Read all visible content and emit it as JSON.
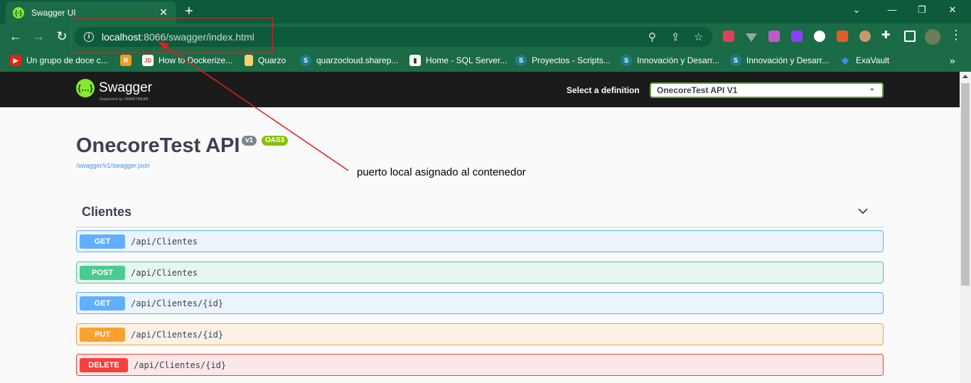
{
  "browser": {
    "tab_title": "Swagger UI",
    "tab_favicon": "{-}",
    "url_host": "localhost",
    "url_rest": ":8066/swagger/index.html",
    "bookmarks": [
      {
        "label": "Un grupo de doce c...",
        "icon": "youtube-icon",
        "color": "#e62117",
        "glyph": "▶"
      },
      {
        "label": "",
        "icon": "r-icon",
        "color": "#f29c1f",
        "glyph": "R"
      },
      {
        "label": "How to Dockerize...",
        "icon": "jd-icon",
        "color": "#ffffff",
        "glyph": "JD"
      },
      {
        "label": "Quarzo",
        "icon": "folder-icon",
        "color": "#f3d36b",
        "glyph": ""
      },
      {
        "label": "quarzocloud.sharep...",
        "icon": "sharepoint-icon",
        "color": "#1a7f8c",
        "glyph": "S"
      },
      {
        "label": "Home - SQL Server...",
        "icon": "chart-icon",
        "color": "#ffffff",
        "glyph": "▮"
      },
      {
        "label": "Proyectos - Scripts...",
        "icon": "sharepoint-icon",
        "color": "#1a7f8c",
        "glyph": "S"
      },
      {
        "label": "Innovación y Desarr...",
        "icon": "sharepoint-icon",
        "color": "#1a7f8c",
        "glyph": "S"
      },
      {
        "label": "Innovación y Desarr...",
        "icon": "sharepoint-icon",
        "color": "#1a7f8c",
        "glyph": "S"
      },
      {
        "label": "ExaVault",
        "icon": "exavault-icon",
        "color": "#3a8ee6",
        "glyph": "◆"
      }
    ],
    "more_bookmarks": "»"
  },
  "swagger": {
    "logo_text": "Swagger",
    "logo_sub": "Supported by SMARTBEAR",
    "definition_label": "Select a definition",
    "definition_value": "OnecoreTest API V1",
    "api_title": "OnecoreTest API",
    "version_badge": "v1",
    "oas_badge": "OAS3",
    "spec_link": "/swagger/v1/swagger.json",
    "section_title": "Clientes",
    "operations": [
      {
        "method": "GET",
        "path": "/api/Clientes"
      },
      {
        "method": "POST",
        "path": "/api/Clientes"
      },
      {
        "method": "GET",
        "path": "/api/Clientes/{id}"
      },
      {
        "method": "PUT",
        "path": "/api/Clientes/{id}"
      },
      {
        "method": "DELETE",
        "path": "/api/Clientes/{id}"
      }
    ]
  },
  "annotation": {
    "text": "puerto local asignado al contenedor",
    "color": "#e02020"
  }
}
